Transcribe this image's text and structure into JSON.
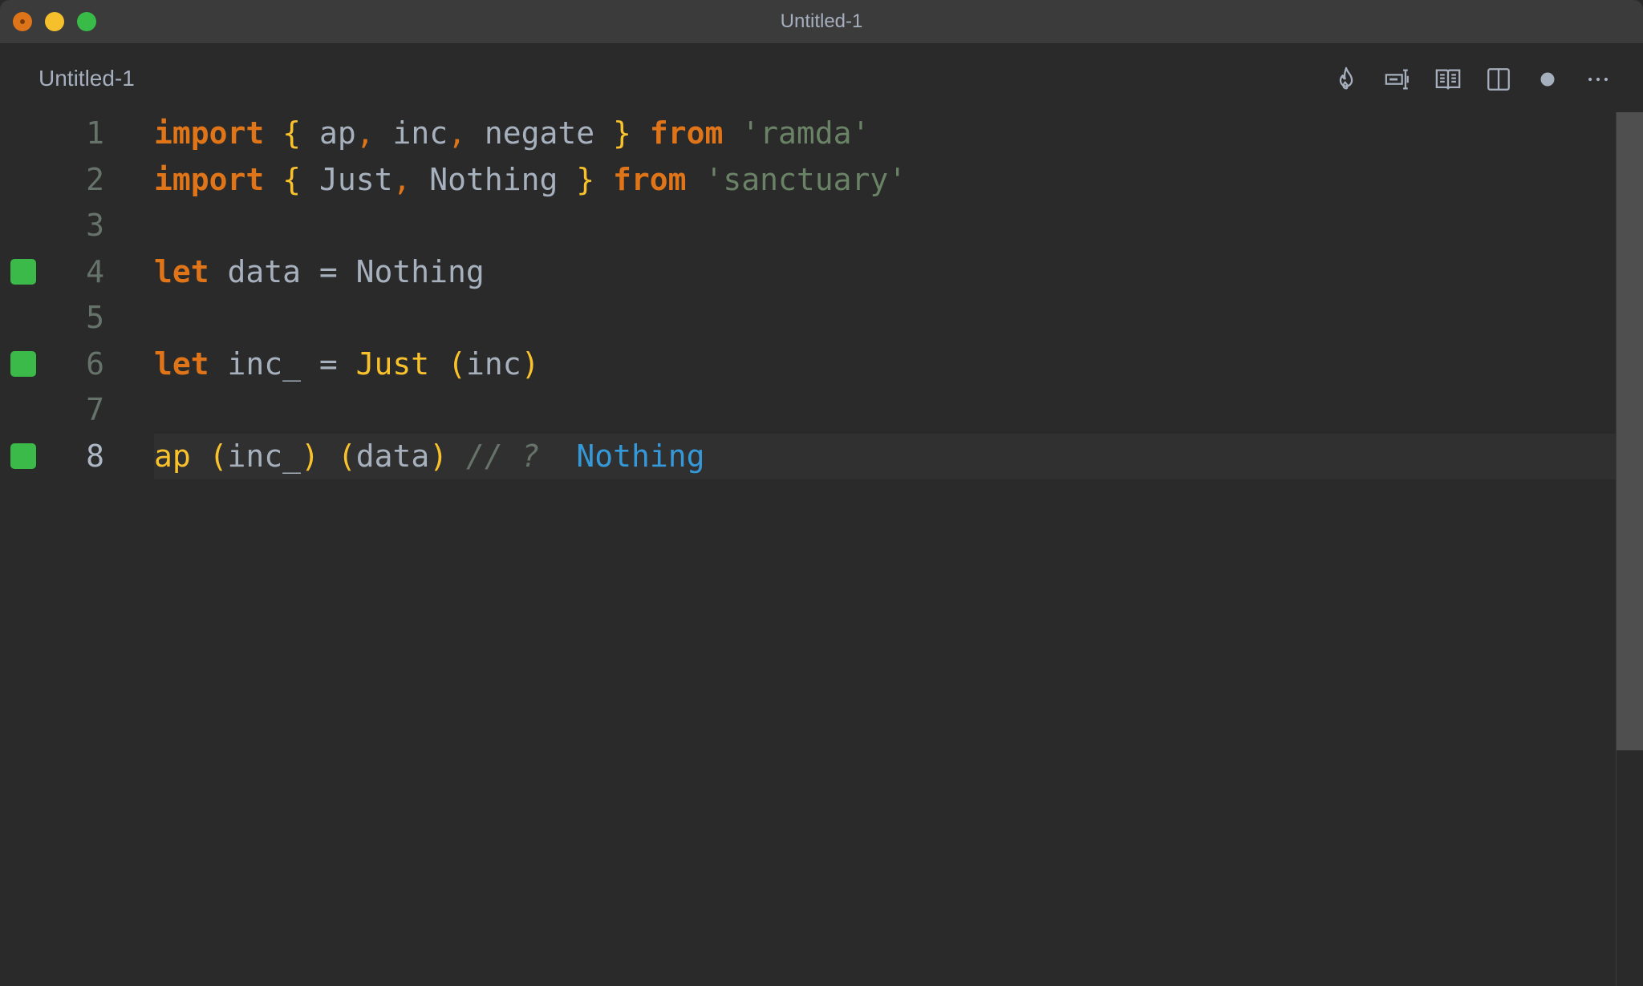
{
  "window": {
    "title": "Untitled-1",
    "traffic_lights": {
      "close": "#de7419",
      "minimize": "#f6c02c",
      "maximize": "#38bb47"
    }
  },
  "tab": {
    "title": "Untitled-1"
  },
  "toolbar": {
    "icons": [
      {
        "name": "flame-icon",
        "label": "Quokka"
      },
      {
        "name": "text-cursor-box-icon",
        "label": "Toggle value display"
      },
      {
        "name": "open-book-icon",
        "label": "Open preview"
      },
      {
        "name": "split-editor-icon",
        "label": "Split editor"
      },
      {
        "name": "unsaved-dot-icon",
        "label": "Unsaved changes"
      },
      {
        "name": "more-actions-icon",
        "label": "More actions"
      }
    ]
  },
  "editor": {
    "lines": [
      {
        "number": "1",
        "marker": false,
        "tokens": [
          {
            "t": "import",
            "c": "kw"
          },
          {
            "t": " "
          },
          {
            "t": "{",
            "c": "brace"
          },
          {
            "t": " ap"
          },
          {
            "t": ",",
            "c": "punct"
          },
          {
            "t": " inc"
          },
          {
            "t": ",",
            "c": "punct"
          },
          {
            "t": " negate "
          },
          {
            "t": "}",
            "c": "brace"
          },
          {
            "t": " "
          },
          {
            "t": "from",
            "c": "kw"
          },
          {
            "t": " "
          },
          {
            "t": "'ramda'",
            "c": "str"
          }
        ]
      },
      {
        "number": "2",
        "marker": false,
        "tokens": [
          {
            "t": "import",
            "c": "kw"
          },
          {
            "t": " "
          },
          {
            "t": "{",
            "c": "brace"
          },
          {
            "t": " Just"
          },
          {
            "t": ",",
            "c": "punct"
          },
          {
            "t": " Nothing "
          },
          {
            "t": "}",
            "c": "brace"
          },
          {
            "t": " "
          },
          {
            "t": "from",
            "c": "kw"
          },
          {
            "t": " "
          },
          {
            "t": "'sanctuary'",
            "c": "str"
          }
        ]
      },
      {
        "number": "3",
        "marker": false,
        "tokens": []
      },
      {
        "number": "4",
        "marker": true,
        "tokens": [
          {
            "t": "let",
            "c": "kw"
          },
          {
            "t": " data = Nothing"
          }
        ]
      },
      {
        "number": "5",
        "marker": false,
        "tokens": []
      },
      {
        "number": "6",
        "marker": true,
        "tokens": [
          {
            "t": "let",
            "c": "kw"
          },
          {
            "t": " inc_ = "
          },
          {
            "t": "Just",
            "c": "fn"
          },
          {
            "t": " "
          },
          {
            "t": "(",
            "c": "brace"
          },
          {
            "t": "inc"
          },
          {
            "t": ")",
            "c": "brace"
          }
        ]
      },
      {
        "number": "7",
        "marker": false,
        "tokens": []
      },
      {
        "number": "8",
        "marker": true,
        "current": true,
        "tokens": [
          {
            "t": "ap",
            "c": "fn"
          },
          {
            "t": " "
          },
          {
            "t": "(",
            "c": "brace"
          },
          {
            "t": "inc_"
          },
          {
            "t": ")",
            "c": "brace"
          },
          {
            "t": " "
          },
          {
            "t": "(",
            "c": "brace"
          },
          {
            "t": "data"
          },
          {
            "t": ")",
            "c": "brace"
          },
          {
            "t": " "
          },
          {
            "t": "// ?",
            "c": "cmt"
          },
          {
            "t": "  "
          },
          {
            "t": "Nothing",
            "c": "result"
          }
        ]
      }
    ],
    "inline_result": "Nothing",
    "colors": {
      "keyword": "#df7418",
      "brace": "#f9c22d",
      "string": "#6a8266",
      "identifier": "#a7b1be",
      "comment": "#66736a",
      "result": "#3598d8",
      "coverage_marker": "#3bba4a"
    }
  },
  "scrollbar": {
    "visible_fraction": 0.73
  }
}
